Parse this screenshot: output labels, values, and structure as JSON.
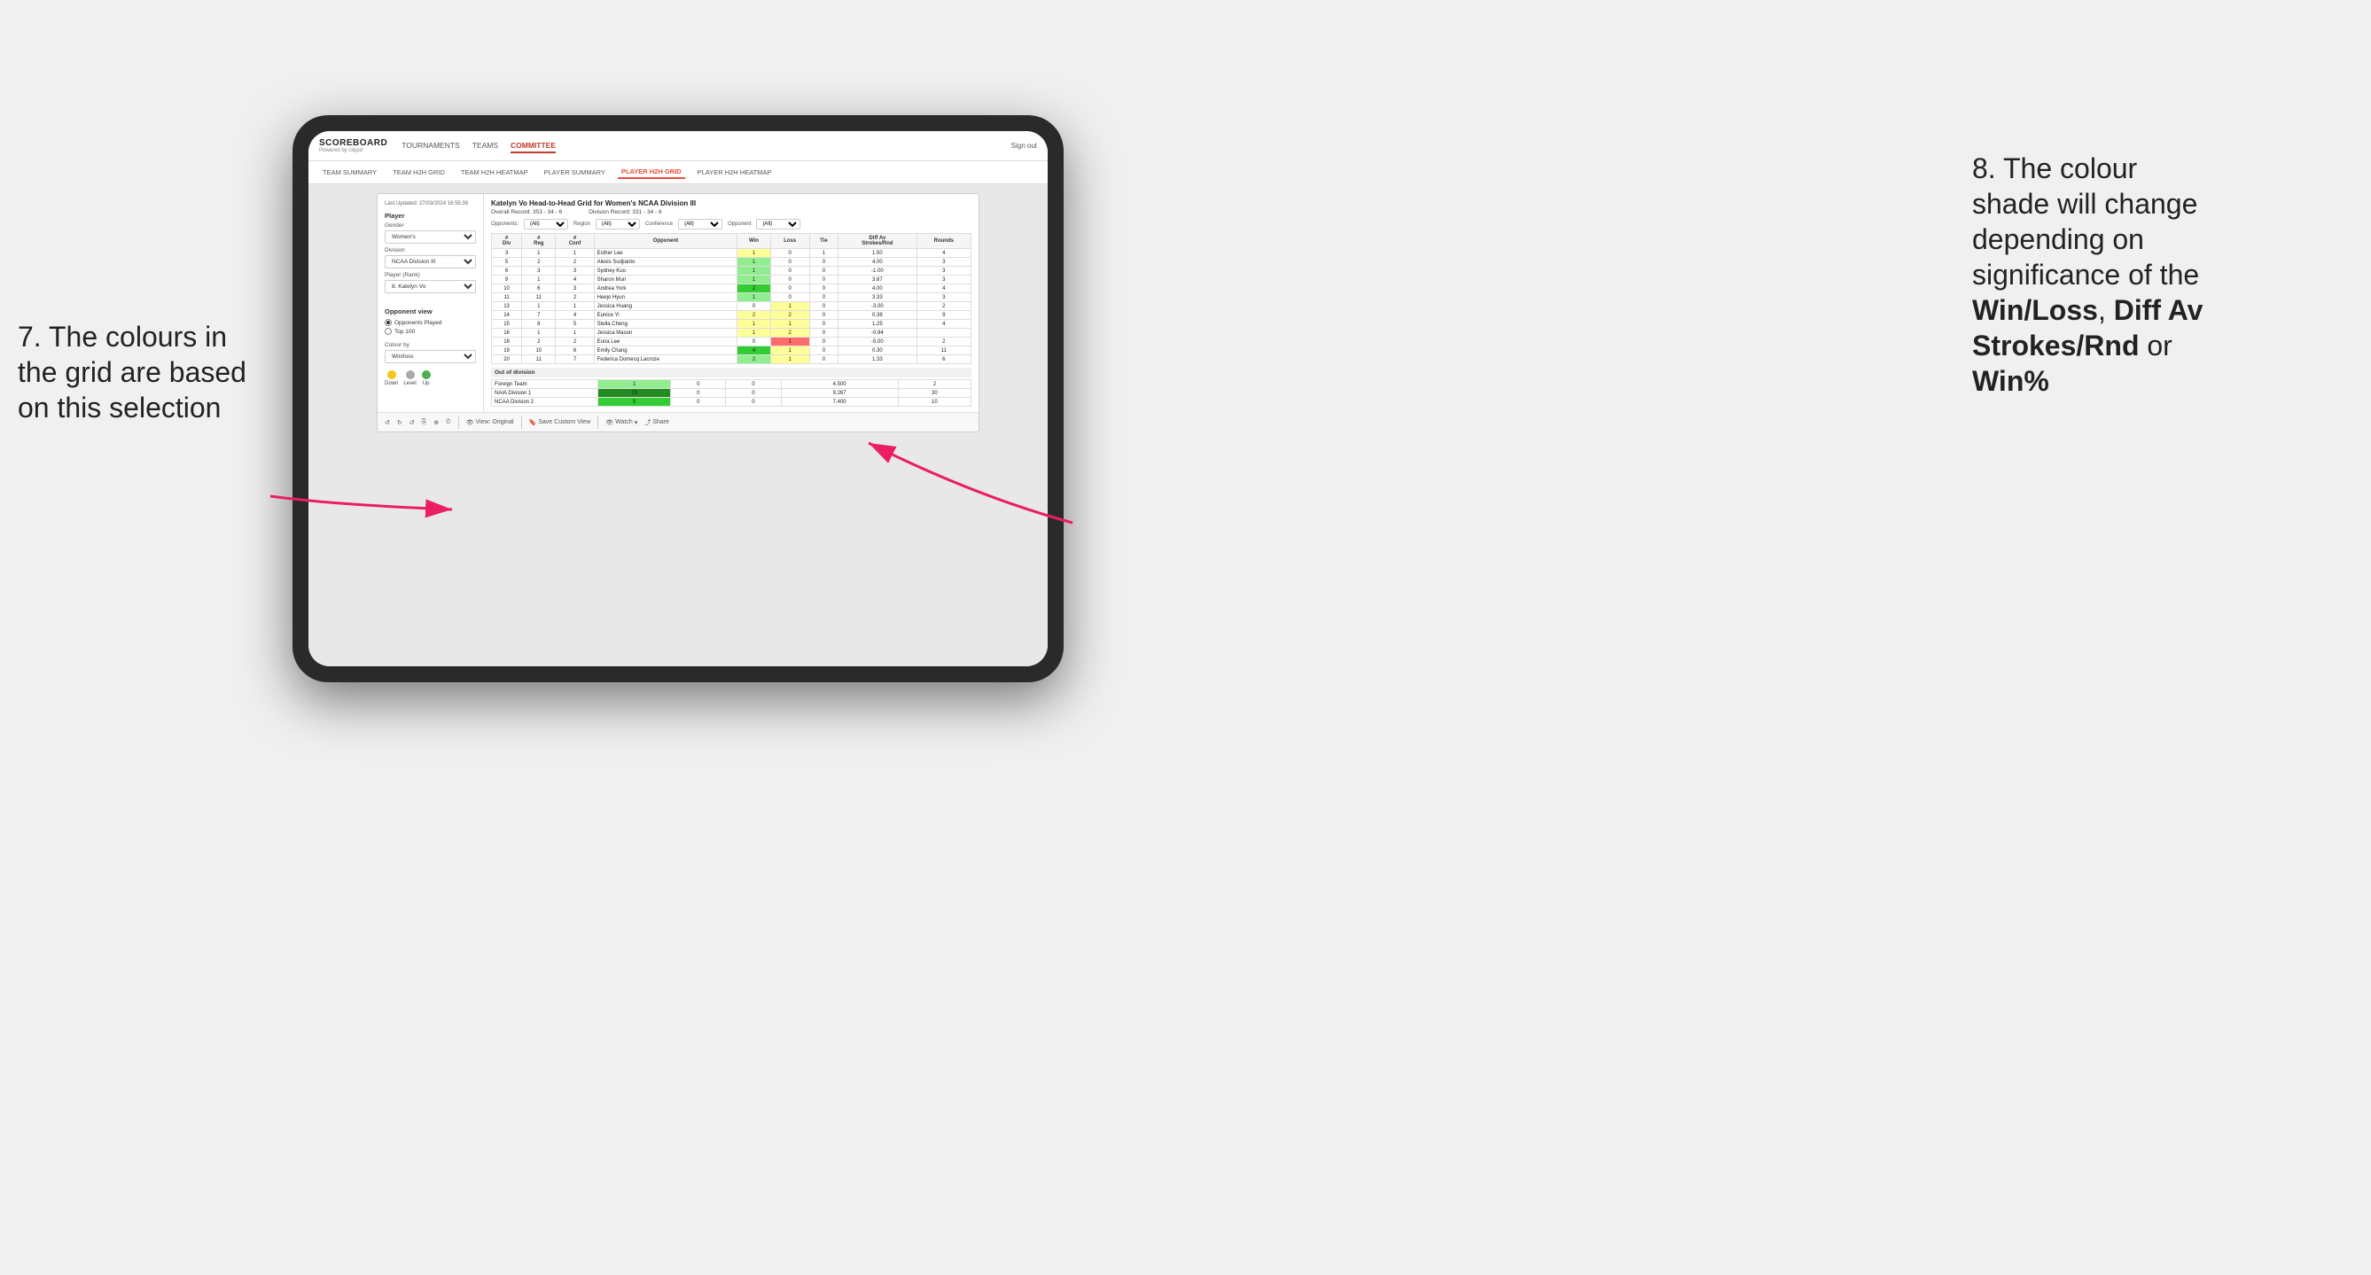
{
  "annotations": {
    "left": {
      "line1": "7. The colours in",
      "line2": "the grid are based",
      "line3": "on this selection"
    },
    "right": {
      "line1": "8. The colour",
      "line2": "shade will change",
      "line3": "depending on",
      "line4": "significance of the",
      "bold1": "Win/Loss",
      "comma1": ", ",
      "bold2": "Diff Av",
      "line5": "Strokes/Rnd",
      "line6": "or",
      "bold3": "Win%"
    }
  },
  "nav": {
    "logo": "SCOREBOARD",
    "logo_sub": "Powered by clippd",
    "items": [
      "TOURNAMENTS",
      "TEAMS",
      "COMMITTEE"
    ],
    "active_item": "COMMITTEE",
    "sign_in": "Sign out"
  },
  "sub_nav": {
    "items": [
      "TEAM SUMMARY",
      "TEAM H2H GRID",
      "TEAM H2H HEATMAP",
      "PLAYER SUMMARY",
      "PLAYER H2H GRID",
      "PLAYER H2H HEATMAP"
    ],
    "active": "PLAYER H2H GRID"
  },
  "sidebar": {
    "timestamp": "Last Updated: 27/03/2024 16:55:38",
    "player_section": "Player",
    "gender_label": "Gender",
    "gender_value": "Women's",
    "division_label": "Division",
    "division_value": "NCAA Division III",
    "player_rank_label": "Player (Rank)",
    "player_rank_value": "8. Katelyn Vo",
    "opponent_view_label": "Opponent view",
    "radio_opponents": "Opponents Played",
    "radio_top100": "Top 100",
    "colour_by_label": "Colour by",
    "colour_by_value": "Win/loss",
    "legend": {
      "down_color": "#f5c518",
      "level_color": "#aaaaaa",
      "up_color": "#4caf50",
      "down_label": "Down",
      "level_label": "Level",
      "up_label": "Up"
    }
  },
  "grid": {
    "title": "Katelyn Vo Head-to-Head Grid for Women's NCAA Division III",
    "overall_record_label": "Overall Record:",
    "overall_record": "353 - 34 - 6",
    "division_record_label": "Division Record:",
    "division_record": "331 - 34 - 6",
    "filters": {
      "opponents_label": "Opponents:",
      "opponents_value": "(All)",
      "region_label": "Region",
      "region_value": "(All)",
      "conference_label": "Conference",
      "conference_value": "(All)",
      "opponent_label": "Opponent",
      "opponent_value": "(All)"
    },
    "columns": [
      "#\nDiv",
      "#\nReg",
      "#\nConf",
      "Opponent",
      "Win",
      "Loss",
      "Tie",
      "Diff Av\nStrokes/Rnd",
      "Rounds"
    ],
    "rows": [
      {
        "div": "3",
        "reg": "1",
        "conf": "1",
        "opponent": "Esther Lee",
        "win": 1,
        "loss": 0,
        "tie": 1,
        "diff": "1.50",
        "rounds": "4",
        "win_color": "yellow",
        "loss_color": "white",
        "tie_color": "white"
      },
      {
        "div": "5",
        "reg": "2",
        "conf": "2",
        "opponent": "Alexis Sudjianto",
        "win": 1,
        "loss": 0,
        "tie": 0,
        "diff": "4.00",
        "rounds": "3",
        "win_color": "green-light",
        "loss_color": "white",
        "tie_color": "white"
      },
      {
        "div": "6",
        "reg": "3",
        "conf": "3",
        "opponent": "Sydney Kuo",
        "win": 1,
        "loss": 0,
        "tie": 0,
        "diff": "-1.00",
        "rounds": "3",
        "win_color": "green-light",
        "loss_color": "white",
        "tie_color": "white"
      },
      {
        "div": "9",
        "reg": "1",
        "conf": "4",
        "opponent": "Sharon Mun",
        "win": 1,
        "loss": 0,
        "tie": 0,
        "diff": "3.67",
        "rounds": "3",
        "win_color": "green-light",
        "loss_color": "white",
        "tie_color": "white"
      },
      {
        "div": "10",
        "reg": "6",
        "conf": "3",
        "opponent": "Andrea York",
        "win": 2,
        "loss": 0,
        "tie": 0,
        "diff": "4.00",
        "rounds": "4",
        "win_color": "green-medium",
        "loss_color": "white",
        "tie_color": "white"
      },
      {
        "div": "11",
        "reg": "11",
        "conf": "2",
        "opponent": "Heejo Hyun",
        "win": 1,
        "loss": 0,
        "tie": 0,
        "diff": "3.33",
        "rounds": "3",
        "win_color": "green-light",
        "loss_color": "white",
        "tie_color": "white"
      },
      {
        "div": "13",
        "reg": "1",
        "conf": "1",
        "opponent": "Jessica Huang",
        "win": 0,
        "loss": 1,
        "tie": 0,
        "diff": "-3.00",
        "rounds": "2",
        "win_color": "white",
        "loss_color": "yellow",
        "tie_color": "white"
      },
      {
        "div": "14",
        "reg": "7",
        "conf": "4",
        "opponent": "Eunice Yi",
        "win": 2,
        "loss": 2,
        "tie": 0,
        "diff": "0.38",
        "rounds": "9",
        "win_color": "yellow",
        "loss_color": "yellow",
        "tie_color": "white"
      },
      {
        "div": "15",
        "reg": "8",
        "conf": "5",
        "opponent": "Stella Cheng",
        "win": 1,
        "loss": 1,
        "tie": 0,
        "diff": "1.25",
        "rounds": "4",
        "win_color": "yellow",
        "loss_color": "yellow",
        "tie_color": "white"
      },
      {
        "div": "16",
        "reg": "1",
        "conf": "1",
        "opponent": "Jessica Mason",
        "win": 1,
        "loss": 2,
        "tie": 0,
        "diff": "-0.94",
        "rounds": "",
        "win_color": "yellow",
        "loss_color": "yellow",
        "tie_color": "white"
      },
      {
        "div": "18",
        "reg": "2",
        "conf": "2",
        "opponent": "Euna Lee",
        "win": 0,
        "loss": 1,
        "tie": 0,
        "diff": "-5.00",
        "rounds": "2",
        "win_color": "white",
        "loss_color": "red-medium",
        "tie_color": "white"
      },
      {
        "div": "19",
        "reg": "10",
        "conf": "6",
        "opponent": "Emily Chang",
        "win": 4,
        "loss": 1,
        "tie": 0,
        "diff": "0.30",
        "rounds": "11",
        "win_color": "green-medium",
        "loss_color": "yellow",
        "tie_color": "white"
      },
      {
        "div": "20",
        "reg": "11",
        "conf": "7",
        "opponent": "Federica Domecq Lacroze",
        "win": 2,
        "loss": 1,
        "tie": 0,
        "diff": "1.33",
        "rounds": "6",
        "win_color": "green-light",
        "loss_color": "yellow",
        "tie_color": "white"
      }
    ],
    "out_of_division": {
      "label": "Out of division",
      "rows": [
        {
          "opponent": "Foreign Team",
          "win": 1,
          "loss": 0,
          "tie": 0,
          "diff": "4.500",
          "rounds": "2",
          "win_color": "green-light"
        },
        {
          "opponent": "NAIA Division 1",
          "win": 15,
          "loss": 0,
          "tie": 0,
          "diff": "9.267",
          "rounds": "30",
          "win_color": "green-dark"
        },
        {
          "opponent": "NCAA Division 2",
          "win": 5,
          "loss": 0,
          "tie": 0,
          "diff": "7.400",
          "rounds": "10",
          "win_color": "green-medium"
        }
      ]
    }
  },
  "toolbar": {
    "view_original": "View: Original",
    "save_custom": "Save Custom View",
    "watch": "Watch",
    "share": "Share"
  }
}
